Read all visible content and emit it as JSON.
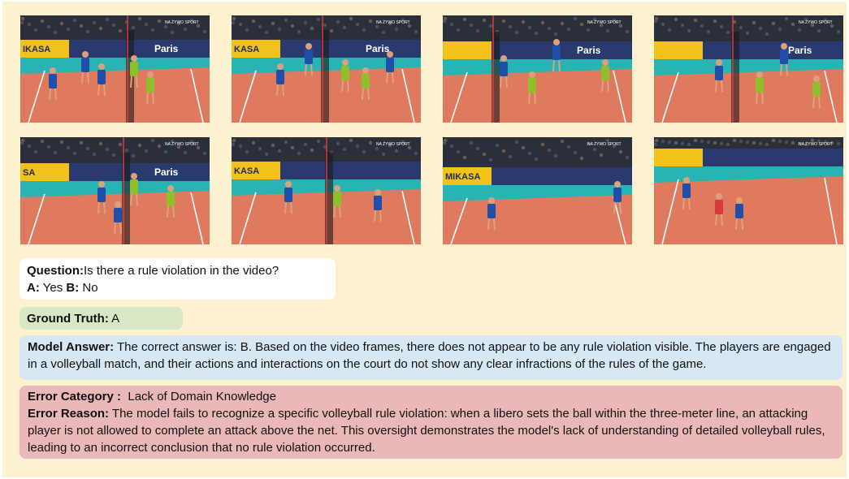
{
  "frames": [
    {
      "banner": "IKASA",
      "city": "Paris",
      "overlay": "NA ŻYWO SPORT"
    },
    {
      "banner": "KASA",
      "city": "Paris",
      "overlay": "NA ŻYWO SPORT"
    },
    {
      "banner": "",
      "city": "Paris",
      "overlay": "NA ŻYWO SPORT"
    },
    {
      "banner": "",
      "city": "Paris",
      "overlay": "NA ŻYWO SPORT"
    },
    {
      "banner": "SA",
      "city": "Paris",
      "overlay": "NA ŻYWO SPORT"
    },
    {
      "banner": "KASA",
      "city": "",
      "overlay": "NA ŻYWO SPORT"
    },
    {
      "banner": "MIKASA",
      "city": "",
      "overlay": "NA ŻYWO SPORT"
    },
    {
      "banner": "",
      "city": "",
      "overlay": "NA ŻYWO SPORT"
    }
  ],
  "question": {
    "label": "Question:",
    "text": "Is there a rule violation in the video?",
    "option_a_label": "A:",
    "option_a_text": " Yes ",
    "option_b_label": "B:",
    "option_b_text": " No"
  },
  "ground_truth": {
    "label": "Ground Truth:",
    "value": " A"
  },
  "model_answer": {
    "label": "Model Answer:",
    "text": " The correct answer is: B. Based on the video frames, there does not appear to be any rule violation visible. The players are engaged in a volleyball match, and their actions and interactions on the court do not show any clear infractions of the rules of the game."
  },
  "error": {
    "category_label": "Error Category :",
    "category_value": "  Lack of Domain Knowledge",
    "reason_label": "Error Reason:",
    "reason_text": " The model fails to recognize a specific volleyball rule violation: when a libero sets the ball within the three-meter line, an attacking player is not allowed to complete an attack above the net. This oversight demonstrates the model's lack of understanding of detailed volleyball rules, leading to an incorrect conclusion that no rule violation occurred."
  },
  "colors": {
    "page_bg": "#fdf1cf",
    "question_bg": "#ffffff",
    "ground_truth_bg": "#d9e8c4",
    "model_answer_bg": "#d7e7f4",
    "error_bg": "#eab8b8",
    "court_orange": "#e07a5f",
    "court_teal": "#2ab3b3"
  }
}
